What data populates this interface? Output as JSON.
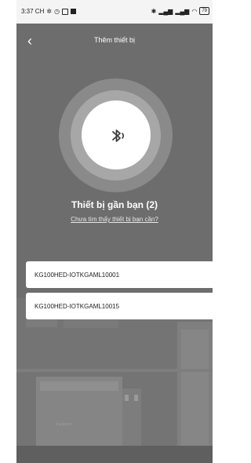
{
  "status_bar": {
    "time": "3:37 CH",
    "battery": "79"
  },
  "header": {
    "title": "Thêm thiết bị"
  },
  "nearby": {
    "title": "Thiết bị gần bạn (2)",
    "help_link": "Chưa tìm thấy thiết bị bạn cần?"
  },
  "devices": [
    {
      "name": "KG100HED-IOTKGAML10001"
    },
    {
      "name": "KG100HED-IOTKGAML10015"
    }
  ],
  "background": {
    "brand_text": "Kangaroo"
  },
  "colors": {
    "overlay": "#6d6d6d",
    "text_light": "#ffffff",
    "card": "#ffffff"
  }
}
